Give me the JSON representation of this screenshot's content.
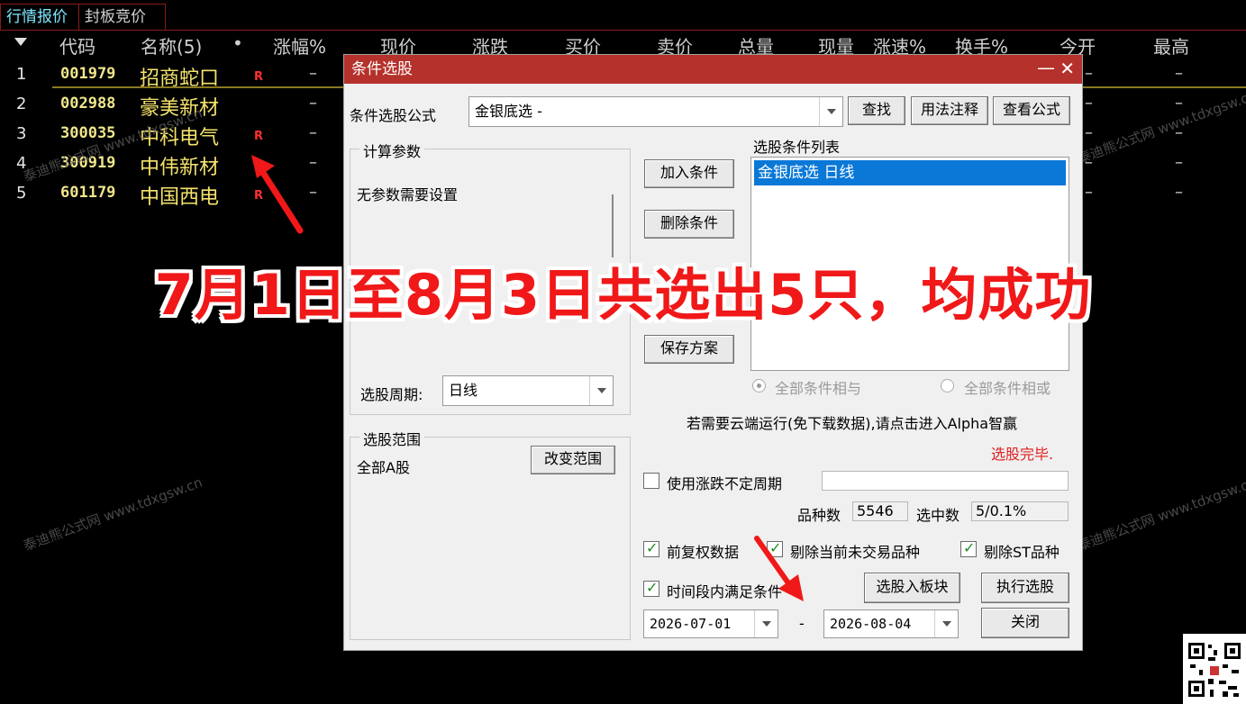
{
  "tabs": [
    "行情报价",
    "封板竞价"
  ],
  "columns": [
    "代码",
    "名称(5)",
    "•",
    "涨幅%",
    "现价",
    "涨跌",
    "买价",
    "卖价",
    "总量",
    "现量",
    "涨速%",
    "换手%",
    "今开",
    "最高"
  ],
  "rows": [
    {
      "idx": "1",
      "code": "001979",
      "name": "招商蛇口",
      "flag": "R",
      "dash": "–"
    },
    {
      "idx": "2",
      "code": "002988",
      "name": "豪美新材",
      "flag": "",
      "dash": "–"
    },
    {
      "idx": "3",
      "code": "300035",
      "name": "中科电气",
      "flag": "R",
      "dash": "–"
    },
    {
      "idx": "4",
      "code": "300919",
      "name": "中伟新材",
      "flag": "",
      "dash": "–"
    },
    {
      "idx": "5",
      "code": "601179",
      "name": "中国西电",
      "flag": "R",
      "dash": "–"
    }
  ],
  "dialog": {
    "title": "条件选股",
    "formula_label": "条件选股公式",
    "formula_value": "金银底选  -",
    "find_btn": "查找",
    "usage_btn": "用法注释",
    "view_btn": "查看公式",
    "params_group": "计算参数",
    "params_text": "无参数需要设置",
    "period_label": "选股周期:",
    "period_value": "日线",
    "range_group": "选股范围",
    "range_value": "全部A股",
    "change_range_btn": "改变范围",
    "cond_list_label": "选股条件列表",
    "cond_item": "金银底选  日线",
    "add_cond_btn": "加入条件",
    "del_cond_btn": "删除条件",
    "save_plan_btn": "保存方案",
    "radio_and": "全部条件相与",
    "radio_or": "全部条件相或",
    "cloud_text": "若需要云端运行(免下载数据),请点击进入Alpha智赢",
    "status_text": "选股完毕.",
    "use_var_period": "使用涨跌不定周期",
    "count_label": "品种数",
    "count_value": "5546",
    "selected_label": "选中数",
    "selected_value": "5/0.1%",
    "chk_prefq": "前复权数据",
    "chk_exclude_untraded": "剔除当前未交易品种",
    "chk_exclude_st": "剔除ST品种",
    "chk_time_range": "时间段内满足条件",
    "to_block_btn": "选股入板块",
    "run_btn": "执行选股",
    "date_from": "2026-07-01",
    "date_sep": "-",
    "date_to": "2026-08-04",
    "close_btn": "关闭"
  },
  "overlay_text": "7月1日至8月3日共选出5只，均成功",
  "watermark": "泰迪熊公式网 www.tdxgsw.cn",
  "accent_color": "#f01818"
}
